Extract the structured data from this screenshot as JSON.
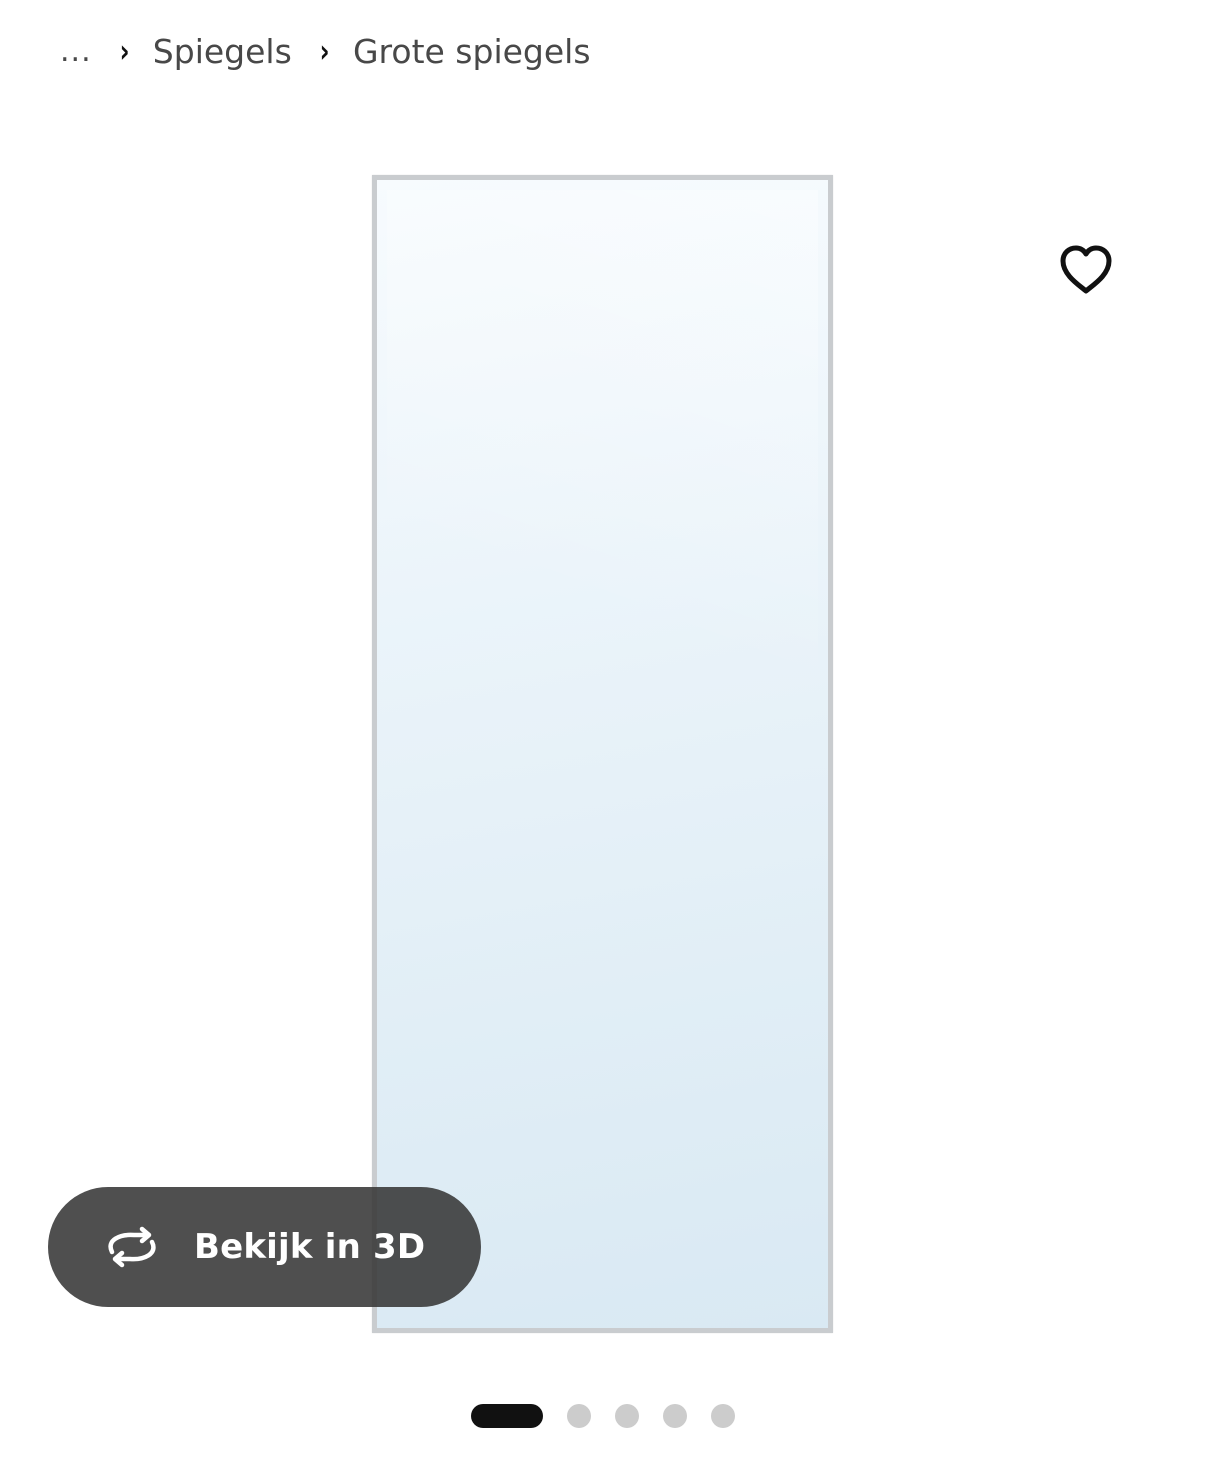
{
  "breadcrumb": {
    "ellipsis": "...",
    "separator": "›",
    "items": [
      {
        "label": "Spiegels"
      },
      {
        "label": "Grote spiegels"
      }
    ]
  },
  "product_image": {
    "icon": "mirror-image",
    "frame_color": "#c9cccf",
    "glass_color": "#e1eef6"
  },
  "favourite": {
    "icon": "heart-icon"
  },
  "view_3d": {
    "label": "Bekijk in 3D",
    "icon": "rotate-3d-icon"
  },
  "carousel": {
    "count": 5,
    "active_index": 0
  }
}
